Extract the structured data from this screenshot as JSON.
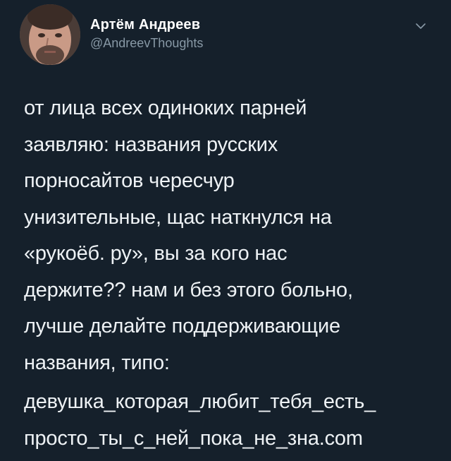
{
  "tweet": {
    "author": {
      "display_name": "Артём Андреев",
      "handle": "@AndreevThoughts"
    },
    "text_part1": "от лица всех одиноких парней\nзаявляю: названия русских\nпорносайтов чересчур\nунизительные, щас наткнулся на\n«рукоёб. ру», вы за кого нас\nдержите?? нам и без этого больно,\nлучше делайте поддерживающие\nназвания, типо:",
    "text_part2": "девушка_которая_любит_тебя_есть_\nпросто_ты_с_ней_пока_не_зна.com"
  },
  "icons": {
    "more": "chevron-down-icon",
    "avatar": "user-avatar"
  },
  "colors": {
    "background": "#15202b",
    "text": "#eef2f5",
    "secondary": "#8899a6"
  }
}
